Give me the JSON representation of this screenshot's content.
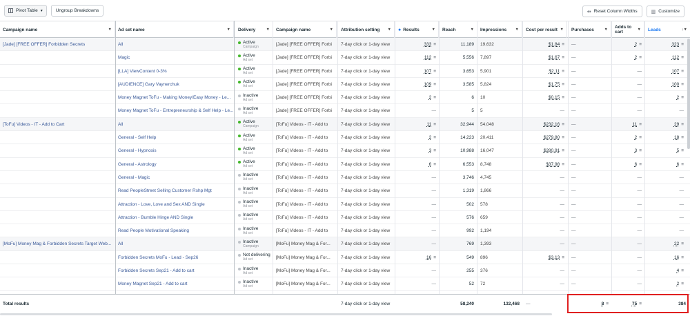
{
  "toolbar": {
    "pivot_label": "Pivot Table",
    "ungroup_label": "Ungroup Breakdowns",
    "reset_label": "Reset Column Widths",
    "customize_label": "Customize"
  },
  "columns": [
    "Campaign name",
    "Ad set name",
    "Delivery",
    "Campaign name",
    "Attribution setting",
    "Results",
    "Reach",
    "Impressions",
    "Cost per result",
    "Purchases",
    "Adds to cart",
    "Leads"
  ],
  "rows": [
    {
      "campaign": "[Jade] [FREE OFFER] Forbidden Secrets",
      "adset": "All",
      "status": "Active",
      "sub": "Campaign",
      "c2": "[Jade] [FREE OFFER] Forbi",
      "attr": "7-day click or 1-day view",
      "results": "333",
      "reach": "11,189",
      "impr": "19,632",
      "cost": "$1.84",
      "purch": "—",
      "atc": "2",
      "leads": "323"
    },
    {
      "campaign": "",
      "adset": "Magic",
      "status": "Active",
      "sub": "Ad set",
      "c2": "[Jade] [FREE OFFER] Forbi",
      "attr": "7-day click or 1-day view",
      "results": "112",
      "reach": "5,556",
      "impr": "7,897",
      "cost": "$1.67",
      "purch": "—",
      "atc": "2",
      "leads": "112"
    },
    {
      "campaign": "",
      "adset": "[LLA] ViewContent 0-3%",
      "status": "Active",
      "sub": "Ad set",
      "c2": "[Jade] [FREE OFFER] Forbi",
      "attr": "7-day click or 1-day view",
      "results": "107",
      "reach": "3,653",
      "impr": "5,901",
      "cost": "$2.11",
      "purch": "—",
      "atc": "—",
      "leads": "107"
    },
    {
      "campaign": "",
      "adset": "[AUDIENCE] Gary Vaynerchuk",
      "status": "Active",
      "sub": "Ad set",
      "c2": "[Jade] [FREE OFFER] Forbi",
      "attr": "7-day click or 1-day view",
      "results": "109",
      "reach": "3,585",
      "impr": "5,824",
      "cost": "$1.75",
      "purch": "—",
      "atc": "—",
      "leads": "100"
    },
    {
      "campaign": "",
      "adset": "Money Magnet ToFu - Making Money/Easy Money - Le...",
      "status": "Inactive",
      "sub": "Ad set",
      "c2": "[Jade] [FREE OFFER] Forbi",
      "attr": "7-day click or 1-day view",
      "results": "2",
      "reach": "6",
      "impr": "10",
      "cost": "$0.15",
      "purch": "—",
      "atc": "—",
      "leads": "2"
    },
    {
      "campaign": "",
      "adset": "Money Magnet ToFu - Entrepreneurship & Self Help - Le...",
      "status": "Inactive",
      "sub": "Ad set",
      "c2": "[Jade] [FREE OFFER] Forbi",
      "attr": "7-day click or 1-day view",
      "results": "—",
      "reach": "5",
      "impr": "5",
      "cost": "—",
      "purch": "—",
      "atc": "—",
      "leads": "—"
    },
    {
      "campaign": "[ToFu] Videos - IT - Add to Cart",
      "adset": "All",
      "status": "Active",
      "sub": "Campaign",
      "c2": "[ToFu] Videos - IT - Add to",
      "attr": "7-day click or 1-day view",
      "results": "11",
      "reach": "32,944",
      "impr": "54,048",
      "cost": "$232.16",
      "purch": "—",
      "atc": "11",
      "leads": "29"
    },
    {
      "campaign": "",
      "adset": "General - Self Help",
      "status": "Active",
      "sub": "Ad set",
      "c2": "[ToFu] Videos - IT - Add to",
      "attr": "7-day click or 1-day view",
      "results": "2",
      "reach": "14,223",
      "impr": "20,411",
      "cost": "$279.80",
      "purch": "—",
      "atc": "2",
      "leads": "18"
    },
    {
      "campaign": "",
      "adset": "General - Hypnosis",
      "status": "Active",
      "sub": "Ad set",
      "c2": "[ToFu] Videos - IT - Add to",
      "attr": "7-day click or 1-day view",
      "results": "3",
      "reach": "10,988",
      "impr": "16,047",
      "cost": "$280.91",
      "purch": "—",
      "atc": "3",
      "leads": "5"
    },
    {
      "campaign": "",
      "adset": "General - Astrology",
      "status": "Active",
      "sub": "Ad set",
      "c2": "[ToFu] Videos - IT - Add to",
      "attr": "7-day click or 1-day view",
      "results": "6",
      "reach": "6,553",
      "impr": "8,748",
      "cost": "$37.98",
      "purch": "—",
      "atc": "6",
      "leads": "6"
    },
    {
      "campaign": "",
      "adset": "General - Magic",
      "status": "Inactive",
      "sub": "Ad set",
      "c2": "[ToFu] Videos - IT - Add to",
      "attr": "7-day click or 1-day view",
      "results": "—",
      "reach": "3,746",
      "impr": "4,745",
      "cost": "—",
      "purch": "—",
      "atc": "—",
      "leads": "—"
    },
    {
      "campaign": "",
      "adset": "Read PeopleStreet Selling Customer Rshp Mgt",
      "status": "Inactive",
      "sub": "Ad set",
      "c2": "[ToFu] Videos - IT - Add to",
      "attr": "7-day click or 1-day view",
      "results": "—",
      "reach": "1,319",
      "impr": "1,866",
      "cost": "—",
      "purch": "—",
      "atc": "—",
      "leads": "—"
    },
    {
      "campaign": "",
      "adset": "Attraction - Love, Love and Sex AND Single",
      "status": "Inactive",
      "sub": "Ad set",
      "c2": "[ToFu] Videos - IT - Add to",
      "attr": "7-day click or 1-day view",
      "results": "—",
      "reach": "502",
      "impr": "578",
      "cost": "—",
      "purch": "—",
      "atc": "—",
      "leads": "—"
    },
    {
      "campaign": "",
      "adset": "Attraction - Bumble Hinge AND Single",
      "status": "Inactive",
      "sub": "Ad set",
      "c2": "[ToFu] Videos - IT - Add to",
      "attr": "7-day click or 1-day view",
      "results": "—",
      "reach": "576",
      "impr": "659",
      "cost": "—",
      "purch": "—",
      "atc": "—",
      "leads": "—"
    },
    {
      "campaign": "",
      "adset": "Read People Motivational Speaking",
      "status": "Inactive",
      "sub": "Ad set",
      "c2": "[ToFu] Videos - IT - Add to",
      "attr": "7-day click or 1-day view",
      "results": "—",
      "reach": "992",
      "impr": "1,194",
      "cost": "—",
      "purch": "—",
      "atc": "—",
      "leads": "—"
    },
    {
      "campaign": "[MoFu] Money Mag & Forbidden Secrets Target Web...",
      "adset": "All",
      "status": "Inactive",
      "sub": "Campaign",
      "c2": "[MoFu] Money Mag & For...",
      "attr": "7-day click or 1-day view",
      "results": "—",
      "reach": "769",
      "impr": "1,393",
      "cost": "—",
      "purch": "—",
      "atc": "—",
      "leads": "22"
    },
    {
      "campaign": "",
      "adset": "Forbidden Secrets MoFu - Lead - Sep26",
      "status": "Not delivering",
      "sub": "Ad set",
      "c2": "[MoFu] Money Mag & For...",
      "attr": "7-day click or 1-day view",
      "results": "16",
      "reach": "549",
      "impr": "896",
      "cost": "$3.13",
      "purch": "—",
      "atc": "—",
      "leads": "16"
    },
    {
      "campaign": "",
      "adset": "Forbidden Secrets Sep21 - Add to cart",
      "status": "Inactive",
      "sub": "Ad set",
      "c2": "[MoFu] Money Mag & For...",
      "attr": "7-day click or 1-day view",
      "results": "—",
      "reach": "255",
      "impr": "376",
      "cost": "—",
      "purch": "—",
      "atc": "—",
      "leads": "4"
    },
    {
      "campaign": "",
      "adset": "Money Magnet Sep21 - Add to cart",
      "status": "Inactive",
      "sub": "Ad set",
      "c2": "[MoFu] Money Mag & For...",
      "attr": "7-day click or 1-day view",
      "results": "—",
      "reach": "52",
      "impr": "72",
      "cost": "—",
      "purch": "—",
      "atc": "—",
      "leads": "2"
    }
  ],
  "totals": {
    "label": "Total results",
    "attr": "7-day click or 1-day view",
    "reach": "58,240",
    "impr": "132,468",
    "cost": "—",
    "purch": "8",
    "atc": "75",
    "leads": "384"
  }
}
